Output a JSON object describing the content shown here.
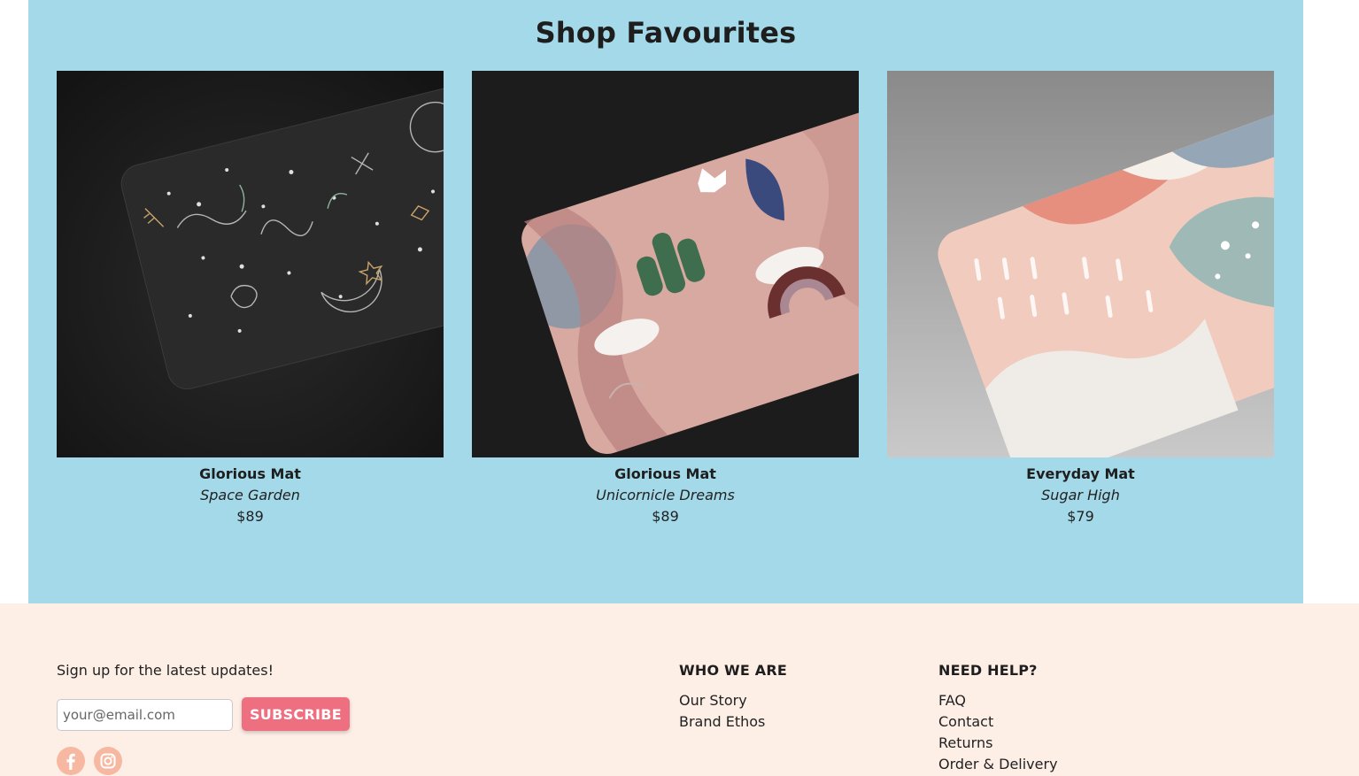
{
  "favourites": {
    "title": "Shop Favourites",
    "products": [
      {
        "name": "Glorious Mat",
        "variant": "Space Garden",
        "price": "$89"
      },
      {
        "name": "Glorious Mat",
        "variant": "Unicornicle Dreams",
        "price": "$89"
      },
      {
        "name": "Everyday Mat",
        "variant": "Sugar High",
        "price": "$79"
      }
    ]
  },
  "footer": {
    "signup_label": "Sign up for the latest updates!",
    "email_placeholder": "your@email.com",
    "subscribe_label": "SUBSCRIBE",
    "social": [
      "facebook-icon",
      "instagram-icon"
    ],
    "who_we_are": {
      "heading": "WHO WE ARE",
      "links": [
        "Our Story",
        "Brand Ethos"
      ]
    },
    "need_help": {
      "heading": "NEED HELP?",
      "links": [
        "FAQ",
        "Contact",
        "Returns",
        "Order & Delivery"
      ]
    }
  },
  "colors": {
    "favourites_bg": "#a3d9e8",
    "footer_bg": "#fdeee6",
    "subscribe_bg": "#ee6f80",
    "social_bg": "#f6b8a1"
  }
}
